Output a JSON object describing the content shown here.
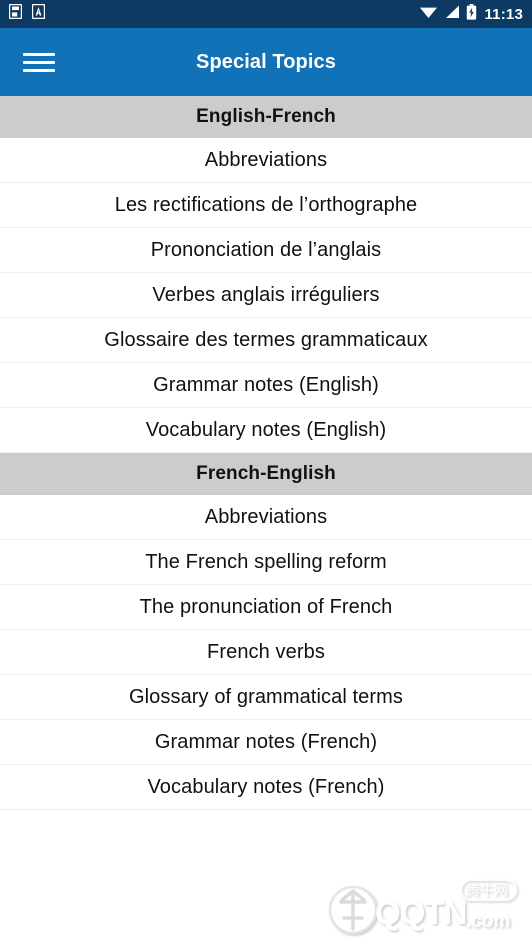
{
  "statusbar": {
    "icons_left": [
      "sdcard-save-icon",
      "font-a-icon"
    ],
    "icons_right": [
      "wifi-icon",
      "cellular-signal-icon",
      "battery-charging-icon"
    ],
    "time": "11:13",
    "background_color": "#0d3a63"
  },
  "appbar": {
    "menu_icon": "hamburger-menu-icon",
    "title": "Special Topics",
    "background_color": "#1272b8",
    "text_color": "#ffffff"
  },
  "list": {
    "section_header_bg": "#cccccc",
    "row_bg": "#ffffff",
    "divider_color": "#eeeeee",
    "sections": [
      {
        "header": "English-French",
        "items": [
          "Abbreviations",
          "Les rectifications de l’orthographe",
          "Prononciation de l’anglais",
          "Verbes anglais irréguliers",
          "Glossaire des termes grammaticaux",
          "Grammar notes (English)",
          "Vocabulary notes (English)"
        ]
      },
      {
        "header": "French-English",
        "items": [
          "Abbreviations",
          "The French spelling reform",
          "The pronunciation of French",
          "French verbs",
          "Glossary of grammatical terms",
          "Grammar notes (French)",
          "Vocabulary notes (French)"
        ]
      }
    ]
  },
  "watermark": {
    "brand": "QQTN",
    "suffix": ".com",
    "chinese": "腾牛网",
    "logo_icon": "qqtn-logo-icon"
  }
}
